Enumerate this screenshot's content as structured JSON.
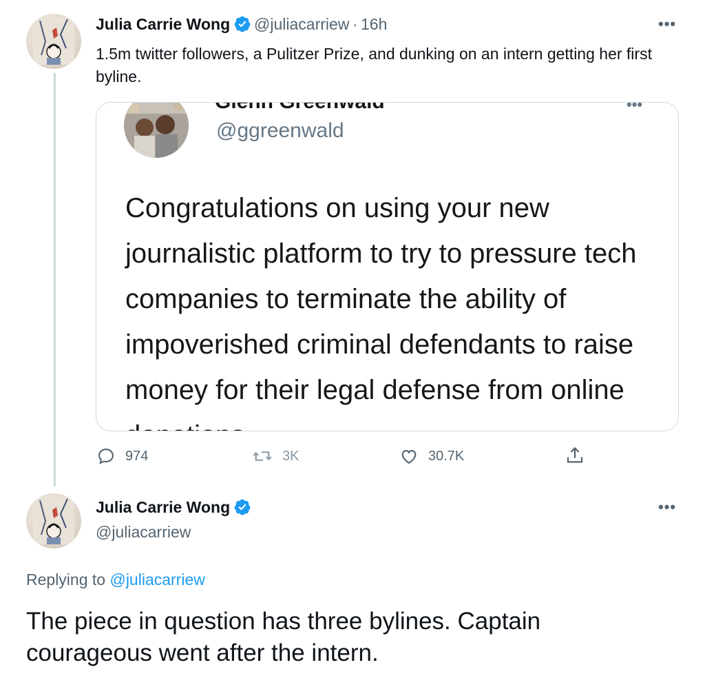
{
  "tweet1": {
    "author_name": "Julia Carrie Wong",
    "handle": "@juliacarriew",
    "separator": "·",
    "time": "16h",
    "more_icon": "more-icon",
    "text": "1.5m twitter followers,  a Pulitzer Prize, and dunking on an intern getting her first byline.",
    "quote": {
      "author_name": "Glenn Greenwald",
      "handle": "@ggreenwald",
      "text": "Congratulations on using your new journalistic platform to try to pressure tech companies to terminate the ability of impoverished criminal defendants to raise money for their legal defense from online donations"
    },
    "actions": {
      "reply_count": "974",
      "retweet_count": "3K",
      "like_count": "30.7K",
      "reply_icon": "reply-icon",
      "retweet_icon": "retweet-icon",
      "like_icon": "like-icon",
      "share_icon": "share-icon"
    }
  },
  "tweet2": {
    "author_name": "Julia Carrie Wong",
    "handle": "@juliacarriew",
    "replying_label": "Replying to",
    "replying_handle": "@juliacarriew",
    "text": "The piece in question has three bylines. Captain courageous went after the intern."
  },
  "colors": {
    "accent": "#1d9bf0",
    "verified": "#1d9bf0",
    "secondary_text": "#536471",
    "border": "#cfd9de"
  }
}
